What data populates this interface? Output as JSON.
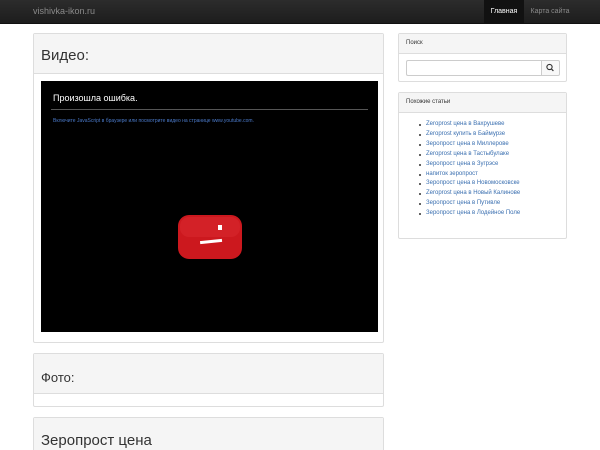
{
  "navbar": {
    "brand": "vishivka-ikon.ru",
    "items": [
      {
        "label": "Главная",
        "active": true
      },
      {
        "label": "Карта сайта",
        "active": false
      }
    ]
  },
  "video": {
    "heading": "Видео:",
    "error_title": "Произошла ошибка.",
    "error_message": "Включите JavaScript в браузере или посмотрите видео на странице www.youtube.com.",
    "icon": "youtube-sad-face-icon"
  },
  "photo": {
    "heading": "Фото:"
  },
  "content": {
    "heading": "Зеропрост цена"
  },
  "search": {
    "title": "Поиск",
    "value": "",
    "placeholder": "",
    "icon": "search-icon"
  },
  "similar": {
    "title": "Похожие статьи",
    "items": [
      "Zeroprost цена в Вахрушеве",
      "Zeroprost купить в Баймурзе",
      "Зеропрост цена в Миллерове",
      "Zeroprost цена в Тастыбулаке",
      "Зеропрост цена в Зугрэсе",
      "напиток зеропрост",
      "Зеропрост цена в Новомосковске",
      "Zeroprost цена в Новый Калинове",
      "Зеропрост цена в Путивле",
      "Зеропрост цена в Лодейное Поле"
    ]
  },
  "colors": {
    "navbar": "#1d1d1d",
    "link": "#3a6fb0",
    "youtube_red": "#cc181e"
  }
}
